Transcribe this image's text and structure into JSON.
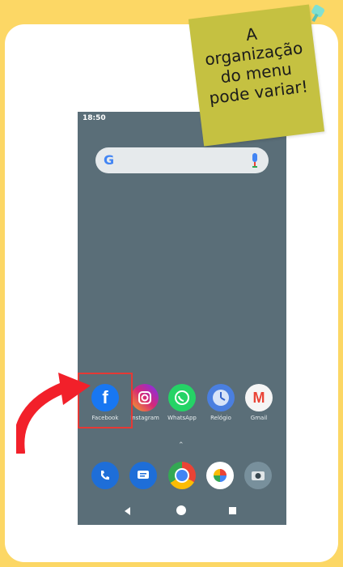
{
  "note": {
    "text": "A\norganização\ndo menu\npode variar!"
  },
  "phone": {
    "status_time": "18:50",
    "search": {
      "logo_letter": "G",
      "mic": "mic-icon"
    },
    "apps": [
      {
        "label": "Facebook",
        "icon": "facebook-icon",
        "color": "#1877f2"
      },
      {
        "label": "Instagram",
        "icon": "instagram-icon",
        "color": "#c13584"
      },
      {
        "label": "WhatsApp",
        "icon": "whatsapp-icon",
        "color": "#25d366"
      },
      {
        "label": "Relógio",
        "icon": "clock-icon",
        "color": "#4a7fe0"
      },
      {
        "label": "Gmail",
        "icon": "gmail-icon",
        "color": "#ea4335"
      }
    ],
    "dock": [
      "phone-icon",
      "messages-icon",
      "chrome-icon",
      "photos-icon",
      "camera-icon"
    ]
  },
  "colors": {
    "background": "#fcd765",
    "note": "#c5c141",
    "highlight": "#e53935",
    "arrow": "#f2202a",
    "wallpaper": "#5a6e78"
  }
}
